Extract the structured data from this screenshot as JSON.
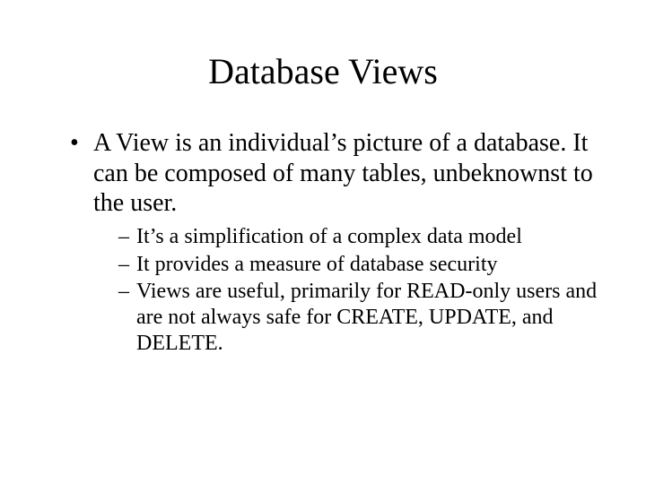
{
  "title": "Database Views",
  "bullets": [
    {
      "text": "A View is an individual’s picture of a database.  It can be composed of many tables, unbeknownst to the user.",
      "sub": [
        "It’s a simplification of a complex data model",
        "It provides a measure of database security",
        "Views are useful, primarily for READ-only users and are not always safe for CREATE, UPDATE, and DELETE."
      ]
    }
  ]
}
